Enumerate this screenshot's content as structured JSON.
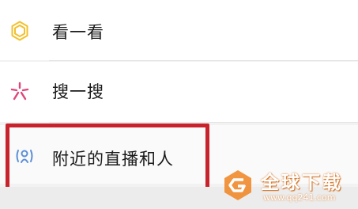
{
  "menu": {
    "items": [
      {
        "label": "看一看",
        "icon": "kan-yi-kan-icon"
      },
      {
        "label": "搜一搜",
        "icon": "sou-yi-sou-icon"
      },
      {
        "label": "附近的直播和人",
        "icon": "nearby-live-icon"
      }
    ]
  },
  "watermark": {
    "title": "全球下载",
    "url": "www.qq241.com"
  },
  "colors": {
    "kan_icon": "#f2c12e",
    "sou_icon": "#e0457b",
    "nearby_icon": "#5b8fd8",
    "highlight": "#c8232c",
    "watermark": "#f08a2c"
  }
}
